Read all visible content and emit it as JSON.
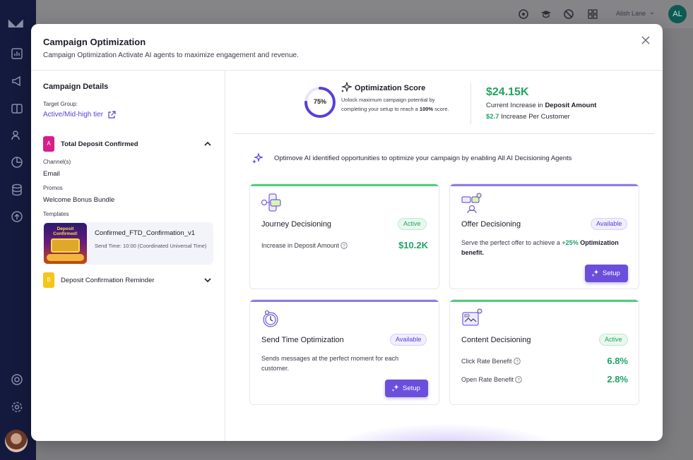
{
  "app": {
    "sidebar_icons": [
      "analytics-icon",
      "megaphone-icon",
      "catalog-icon",
      "users-icon",
      "pie-chart-icon",
      "database-icon",
      "upload-icon",
      "help-icon",
      "settings-icon"
    ],
    "top_icons": [
      "ai-assistant-icon",
      "academy-icon",
      "support-icon",
      "apps-grid-icon"
    ],
    "user_name": "Alish Lane",
    "user_initials": "AL"
  },
  "modal": {
    "title": "Campaign Optimization",
    "subtitle": "Campaign Optimization Activate AI agents to maximize engagement and revenue."
  },
  "details": {
    "title": "Campaign Details",
    "target_group_label": "Target Group:",
    "target_group_value": "Active/Mid-high tier",
    "steps": [
      {
        "badge": "A",
        "name": "Total Deposit Confirmed",
        "color": "#d61f8a",
        "expanded": true
      },
      {
        "badge": "B",
        "name": "Deposit Confirmation Reminder",
        "color": "#f5c518",
        "expanded": false
      }
    ],
    "channels_label": "Channel(s)",
    "channels_value": "Email",
    "promos_label": "Promos",
    "promos_value": "Welcome Bonus Bundle",
    "templates_label": "Templates",
    "template": {
      "thumb_text": "Deposit Confirmed!",
      "name": "Confirmed_FTD_Confirmation_v1",
      "send_time": "Send Time: 10:00 (Coordinated Universal Time)"
    }
  },
  "score": {
    "percent": 75,
    "percent_label": "75%",
    "title": "Optimization Score",
    "desc_pre": "Unlock maximum campaign potential by completing your setup to reach a ",
    "desc_bold": "100%",
    "desc_post": " score.",
    "amount": "$24.15K",
    "increase_pre": "Current Increase in ",
    "increase_bold": "Deposit Amount",
    "per_value": "$2.7",
    "per_label": " Increase Per Customer"
  },
  "opportunity_text": "Optimove AI identified opportunities to optimize your campaign by enabling All AI Decisioning Agents",
  "agents": {
    "journey": {
      "name": "Journey Decisioning",
      "status": "Active",
      "metric_label": "Increase in Deposit Amount",
      "metric_value": "$10.2K"
    },
    "offer": {
      "name": "Offer Decisioning",
      "status": "Available",
      "desc_pre": "Serve the perfect offer to achieve a ",
      "desc_hl": "+25%",
      "desc_bold": " Optimization benefit.",
      "button": "Setup"
    },
    "send_time": {
      "name": "Send Time Optimization",
      "status": "Available",
      "desc": "Sends messages at the perfect moment for each customer.",
      "button": "Setup"
    },
    "content": {
      "name": "Content Decisioning",
      "status": "Active",
      "metric1_label": "Click Rate Benefit",
      "metric1_value": "6.8%",
      "metric2_label": "Open Rate Benefit",
      "metric2_value": "2.8%"
    }
  },
  "colors": {
    "accent": "#6b4fdc",
    "success": "#1fa463",
    "sidebar": "#141a3d"
  }
}
